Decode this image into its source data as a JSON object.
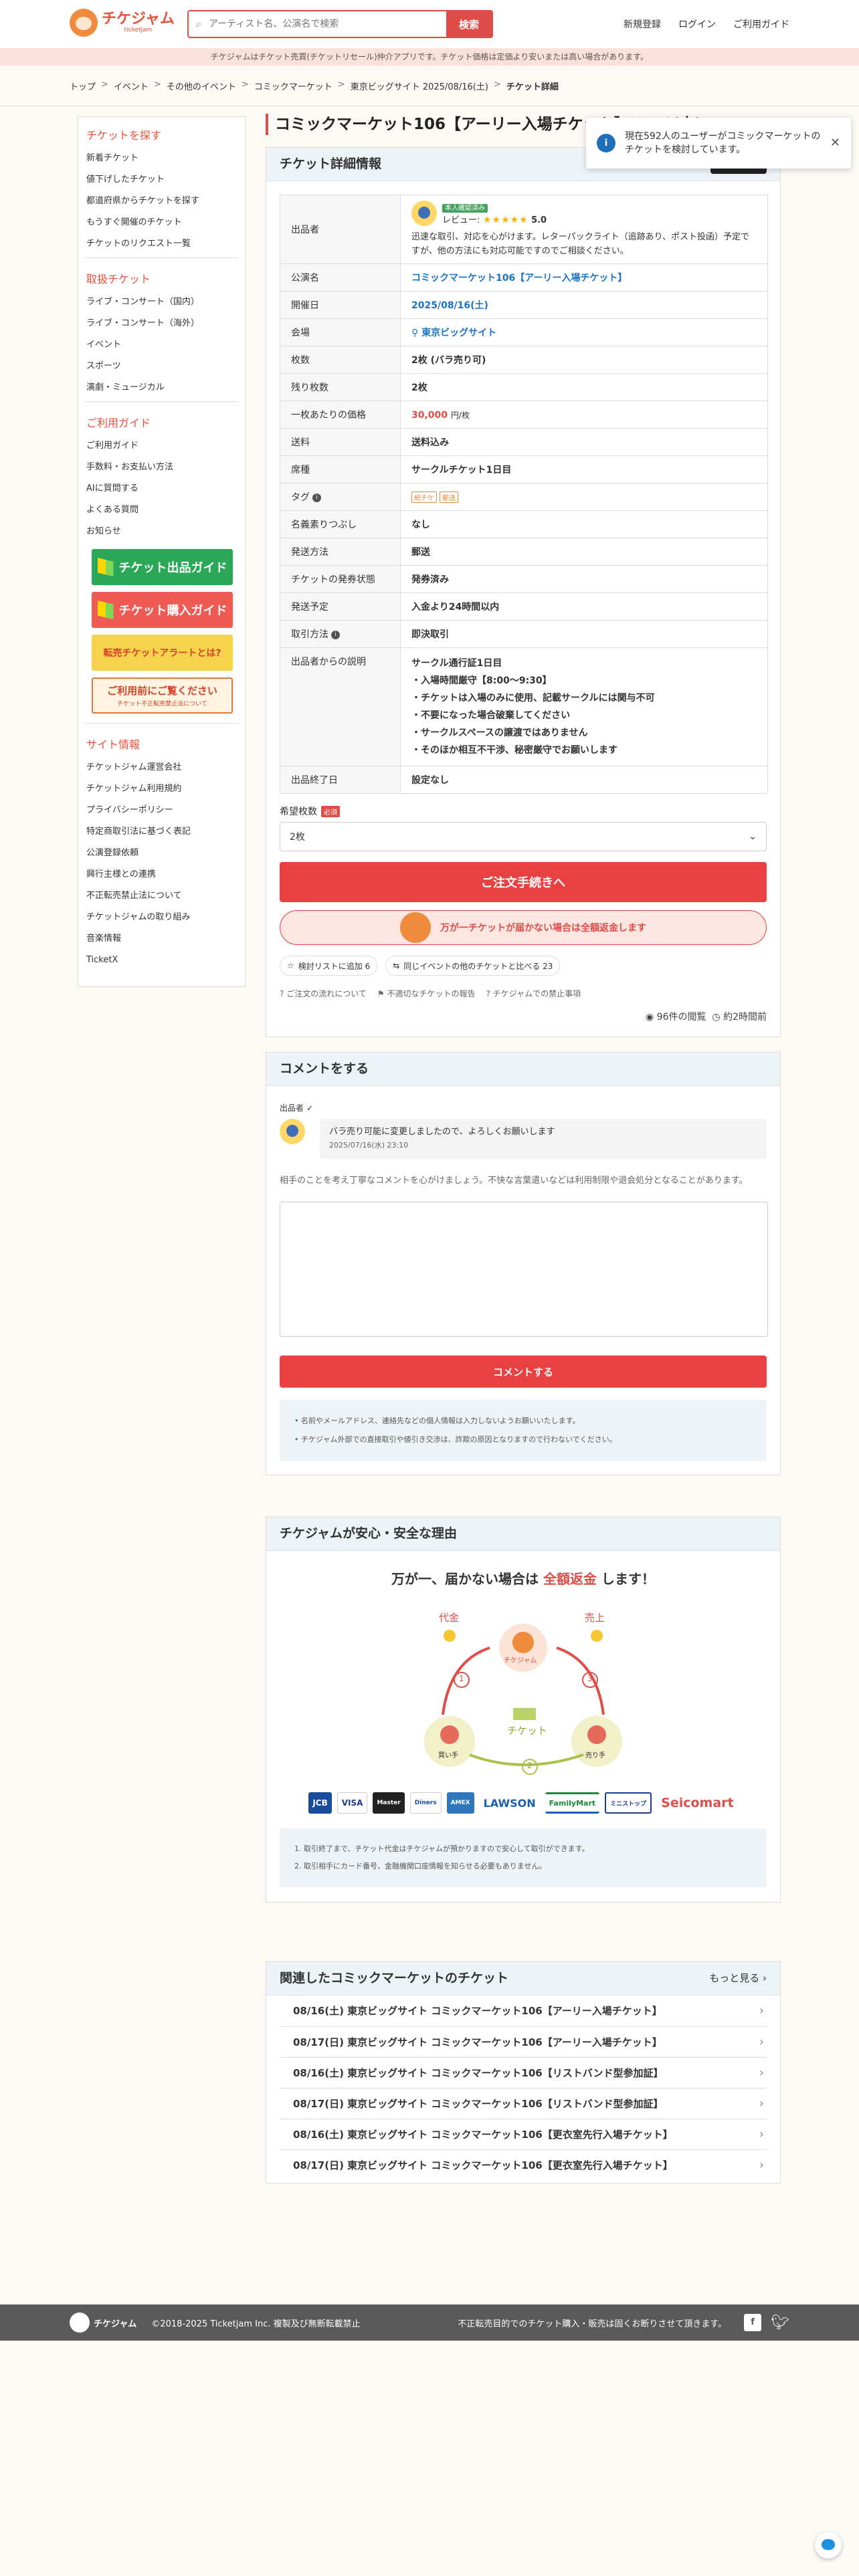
{
  "header": {
    "logo_text": "チケジャム",
    "logo_sub": "ticketjam",
    "search_placeholder": "アーティスト名、公演名で検索",
    "search_button": "検索",
    "nav": [
      "新規登録",
      "ログイン",
      "ご利用ガイド"
    ]
  },
  "notice": "チケジャムはチケット売買(チケットリセール)仲介アプリです。チケット価格は定価より安いまたは高い場合があります。",
  "breadcrumb": [
    "トップ",
    "イベント",
    "その他のイベント",
    "コミックマーケット",
    "東京ビッグサイト 2025/08/16(土)",
    "チケット詳細"
  ],
  "sidebar": {
    "sections": [
      {
        "title": "チケットを探す",
        "items": [
          "新着チケット",
          "値下げしたチケット",
          "都道府県からチケットを探す",
          "もうすぐ開催のチケット",
          "チケットのリクエスト一覧"
        ]
      },
      {
        "title": "取扱チケット",
        "items": [
          "ライブ・コンサート（国内）",
          "ライブ・コンサート（海外）",
          "イベント",
          "スポーツ",
          "演劇・ミュージカル"
        ]
      },
      {
        "title": "ご利用ガイド",
        "items": [
          "ご利用ガイド",
          "手数料・お支払い方法",
          "AIに質問する",
          "よくある質問",
          "お知らせ"
        ]
      }
    ],
    "banners": [
      "チケット出品ガイド",
      "チケット購入ガイド",
      "転売チケットアラートとは?",
      "ご利用前にご覧ください"
    ],
    "banner_sub": "チケット不正転売禁止法について",
    "site_info_title": "サイト情報",
    "site_info": [
      "チケットジャム運営会社",
      "チケットジャム利用規約",
      "プライバシーポリシー",
      "特定商取引法に基づく表記",
      "公演登録依頼",
      "興行主様との連携",
      "不正転売禁止法について",
      "チケットジャムの取り組み",
      "音楽情報",
      "TicketX"
    ]
  },
  "page_title": "コミックマーケット106【アーリー入場チケット】 8/16(土)",
  "detail": {
    "card_title": "チケット詳細情報",
    "seller_label": "出品者",
    "seller_badge": "本人確認済み",
    "review_label": "レビュー:",
    "stars": "★★★★★",
    "rating": "5.0",
    "seller_desc": "迅速な取引、対応を心がけます。レターパックライト（追跡あり、ポスト投函）予定ですが、他の方法にも対応可能ですのでご相談ください。",
    "rows": [
      {
        "k": "公演名",
        "v": "コミックマーケット106【アーリー入場チケット】"
      },
      {
        "k": "開催日",
        "v": "2025/08/16(土)"
      },
      {
        "k": "会場",
        "v": "東京ビッグサイト"
      },
      {
        "k": "枚数",
        "v": "2枚 (バラ売り可)"
      },
      {
        "k": "残り枚数",
        "v": "2枚"
      },
      {
        "k": "一枚あたりの価格",
        "v": "30,000",
        "unit": "円/枚"
      },
      {
        "k": "送料",
        "v": "送料込み"
      },
      {
        "k": "席種",
        "v": "サークルチケット1日目"
      },
      {
        "k": "タグ",
        "v": ""
      },
      {
        "k": "名義素りつぶし",
        "v": "なし"
      },
      {
        "k": "発送方法",
        "v": "郵送"
      },
      {
        "k": "チケットの発券状態",
        "v": "発券済み"
      },
      {
        "k": "発送予定",
        "v": "入金より24時間以内"
      },
      {
        "k": "取引方法",
        "v": "即決取引"
      }
    ],
    "tags": [
      "紙チケ",
      "郵送"
    ],
    "desc_label": "出品者からの説明",
    "desc_lines": [
      "サークル通行証1日目",
      "・入場時間厳守【8:00〜9:30】",
      "・チケットは入場のみに使用、記載サークルには関与不可",
      "・不要になった場合破棄してください",
      "・サークルスペースの譲渡ではありません",
      "・そのほか相互不干渉、秘密厳守でお願いします"
    ],
    "end_label": "出品終了日",
    "end_value": "設定なし",
    "qty_label": "希望枚数",
    "qty_required": "必須",
    "qty_value": "2枚",
    "order_button": "ご注文手続きへ",
    "refund_text": "万が一チケットが届かない場合は全額返金します",
    "wishlist": "検討リストに追加 6",
    "compare": "同じイベントの他のチケットと比べる 23",
    "links": [
      "ご注文の流れについて",
      "不適切なチケットの報告",
      "チケジャムでの禁止事項"
    ],
    "views": "96件の閲覧",
    "posted": "約2時間前"
  },
  "comment": {
    "card_title": "コメントをする",
    "author_label": "出品者",
    "text": "バラ売り可能に変更しましたので、よろしくお願いします",
    "date": "2025/07/16(水) 23:10",
    "hint": "相手のことを考え丁寧なコメントを心がけましょう。不快な言葉遣いなどは利用制限や退会処分となることがあります。",
    "submit": "コメントする",
    "notes": [
      "名前やメールアドレス、連絡先などの個人情報は入力しないようお願いいたします。",
      "チケジャム外部での直接取引や値引き交渉は、詐欺の原因となりますので行わないでください。"
    ]
  },
  "safety": {
    "card_title": "チケジャムが安心・安全な理由",
    "headline_pre": "万が一、届かない場合は",
    "headline_hl": "全額返金",
    "headline_post": "します！",
    "diagram": {
      "left": "代金",
      "right": "売上",
      "center": "チケジャム",
      "ticket": "チケット",
      "buyer": "買い手",
      "seller": "売り手"
    },
    "payments": [
      "JCB",
      "VISA",
      "Master",
      "Diners",
      "AMEX",
      "LAWSON",
      "FamilyMart",
      "ミニストップ",
      "Seicomart"
    ],
    "notes": [
      "取引終了まで、チケット代金はチケジャムが預かりますので安心して取引ができます。",
      "取引相手にカード番号、金融機関口座情報を知らせる必要もありません。"
    ]
  },
  "related": {
    "card_title": "関連したコミックマーケットのチケット",
    "more": "もっと見る",
    "items": [
      "08/16(土) 東京ビッグサイト コミックマーケット106【アーリー入場チケット】",
      "08/17(日) 東京ビッグサイト コミックマーケット106【アーリー入場チケット】",
      "08/16(土) 東京ビッグサイト コミックマーケット106【リストバンド型参加証】",
      "08/17(日) 東京ビッグサイト コミックマーケット106【リストバンド型参加証】",
      "08/16(土) 東京ビッグサイト コミックマーケット106【更衣室先行入場チケット】",
      "08/17(日) 東京ビッグサイト コミックマーケット106【更衣室先行入場チケット】"
    ]
  },
  "footer": {
    "copyright": "©2018-2025 Ticketjam Inc. 複製及び無断転載禁止",
    "statement": "不正転売目的でのチケット購入・販売は固くお断りさせて頂きます。"
  },
  "toast": {
    "text": "現在592人のユーザーがコミックマーケットのチケットを検討しています。"
  }
}
